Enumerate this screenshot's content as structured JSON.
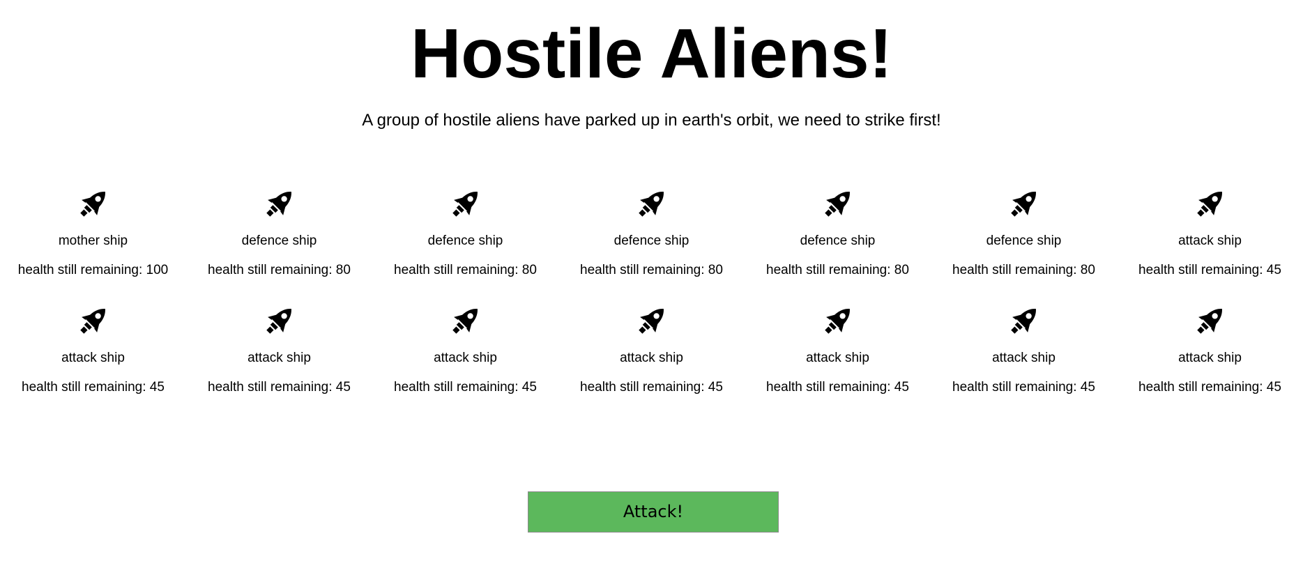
{
  "page": {
    "title": "Hostile Aliens!",
    "subtitle": "A group of hostile aliens have parked up in earth's orbit, we need to strike first!"
  },
  "ships": [
    {
      "type": "mother ship",
      "health_text": "health still remaining: 100",
      "health": 100,
      "icon": "rocket-icon"
    },
    {
      "type": "defence ship",
      "health_text": "health still remaining: 80",
      "health": 80,
      "icon": "rocket-icon"
    },
    {
      "type": "defence ship",
      "health_text": "health still remaining: 80",
      "health": 80,
      "icon": "rocket-icon"
    },
    {
      "type": "defence ship",
      "health_text": "health still remaining: 80",
      "health": 80,
      "icon": "rocket-icon"
    },
    {
      "type": "defence ship",
      "health_text": "health still remaining: 80",
      "health": 80,
      "icon": "rocket-icon"
    },
    {
      "type": "defence ship",
      "health_text": "health still remaining: 80",
      "health": 80,
      "icon": "rocket-icon"
    },
    {
      "type": "attack ship",
      "health_text": "health still remaining: 45",
      "health": 45,
      "icon": "rocket-icon"
    },
    {
      "type": "attack ship",
      "health_text": "health still remaining: 45",
      "health": 45,
      "icon": "rocket-icon"
    },
    {
      "type": "attack ship",
      "health_text": "health still remaining: 45",
      "health": 45,
      "icon": "rocket-icon"
    },
    {
      "type": "attack ship",
      "health_text": "health still remaining: 45",
      "health": 45,
      "icon": "rocket-icon"
    },
    {
      "type": "attack ship",
      "health_text": "health still remaining: 45",
      "health": 45,
      "icon": "rocket-icon"
    },
    {
      "type": "attack ship",
      "health_text": "health still remaining: 45",
      "health": 45,
      "icon": "rocket-icon"
    },
    {
      "type": "attack ship",
      "health_text": "health still remaining: 45",
      "health": 45,
      "icon": "rocket-icon"
    },
    {
      "type": "attack ship",
      "health_text": "health still remaining: 45",
      "health": 45,
      "icon": "rocket-icon"
    }
  ],
  "attack_button": {
    "label": "Attack!",
    "color": "#5cb85c"
  }
}
